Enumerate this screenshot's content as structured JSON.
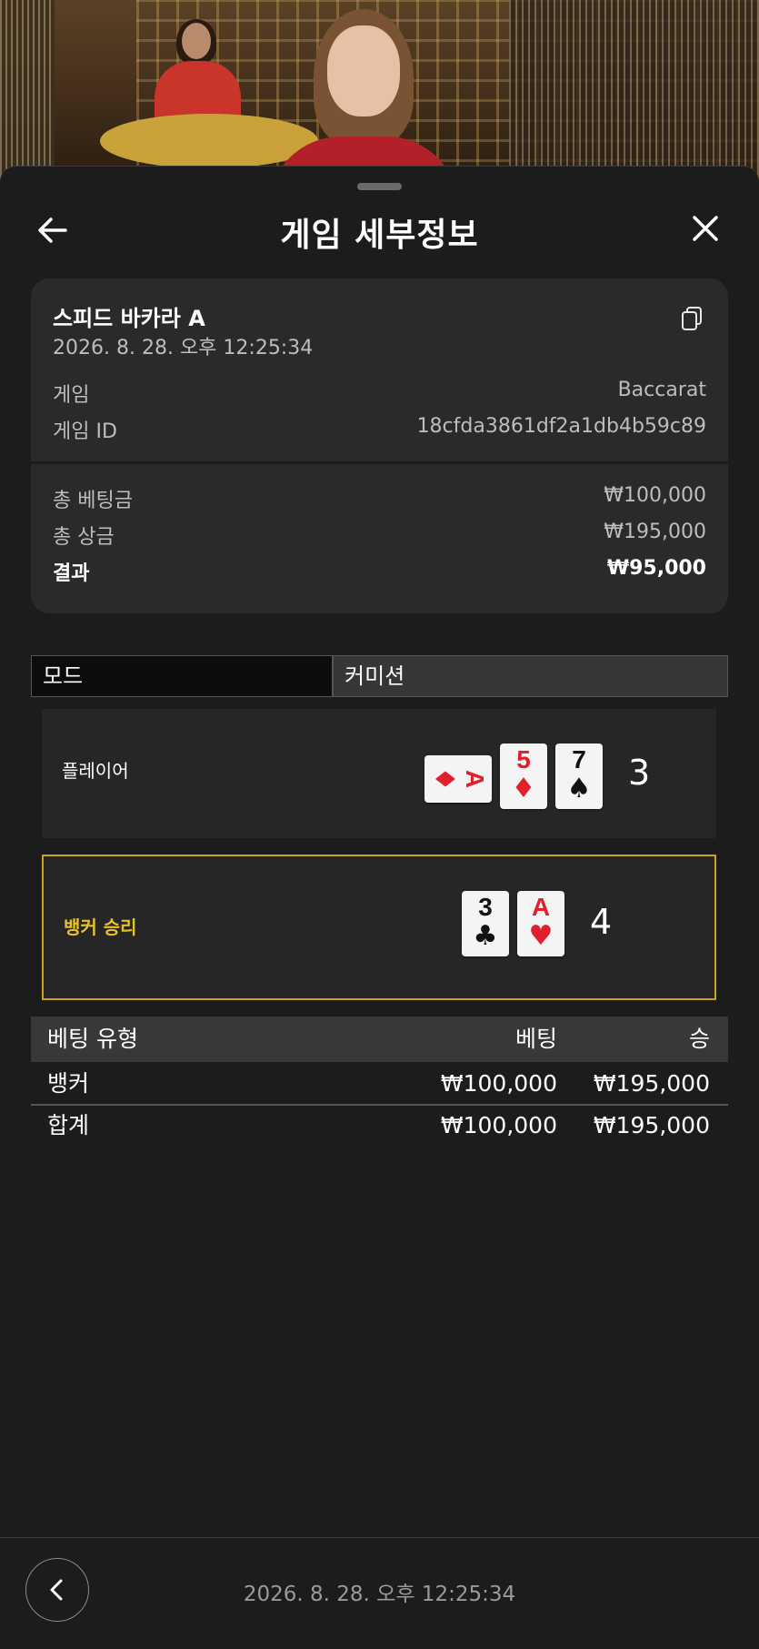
{
  "header": {
    "title": "게임 세부정보"
  },
  "card": {
    "game_name": "스피드 바카라 A",
    "datetime": "2026. 8. 28. 오후 12:25:34",
    "game_label": "게임",
    "game_value": "Baccarat",
    "game_id_label": "게임 ID",
    "game_id_value": "18cfda3861df2a1db4b59c89",
    "total_bet_label": "총 베팅금",
    "total_bet_value": "₩100,000",
    "total_win_label": "총 상금",
    "total_win_value": "₩195,000",
    "result_label": "결과",
    "result_value": "₩95,000"
  },
  "tabs": {
    "mode": "모드",
    "commission": "커미션"
  },
  "player": {
    "label": "플레이어",
    "score": "3",
    "cards": [
      {
        "rank": "A",
        "suit": "♦",
        "color": "#e0202a",
        "orientation": "sideways"
      },
      {
        "rank": "5",
        "suit": "♦",
        "color": "#e0202a"
      },
      {
        "rank": "7",
        "suit": "♠",
        "color": "#111111"
      }
    ]
  },
  "banker": {
    "label": "뱅커 승리",
    "label_color": "#e6c229",
    "border_color": "#c9a51e",
    "score": "4",
    "cards": [
      {
        "rank": "3",
        "suit": "♣",
        "color": "#111111"
      },
      {
        "rank": "A",
        "suit": "♥",
        "color": "#e0202a"
      }
    ]
  },
  "bets": {
    "headers": [
      "베팅 유형",
      "베팅",
      "승"
    ],
    "rows": [
      {
        "type": "뱅커",
        "bet": "₩100,000",
        "win": "₩195,000"
      }
    ],
    "total": {
      "type": "합계",
      "bet": "₩100,000",
      "win": "₩195,000"
    }
  },
  "footer": {
    "datetime": "2026. 8. 28. 오후 12:25:34"
  }
}
